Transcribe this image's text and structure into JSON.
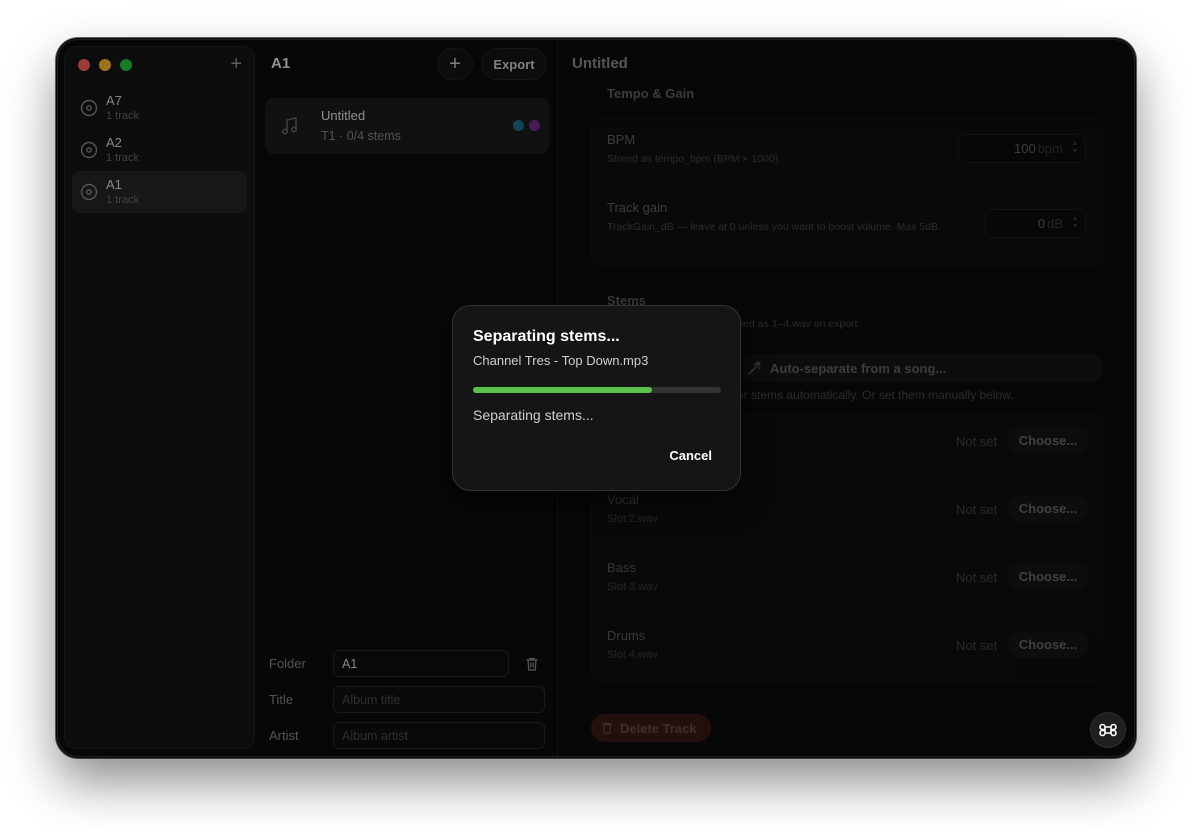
{
  "sidebar": {
    "add_label": "+",
    "items": [
      {
        "name": "A7",
        "sub": "1 track",
        "selected": false
      },
      {
        "name": "A2",
        "sub": "1 track",
        "selected": false
      },
      {
        "name": "A1",
        "sub": "1 track",
        "selected": true
      }
    ]
  },
  "album": {
    "title": "A1",
    "add_label": "+",
    "export_label": "Export",
    "track": {
      "title": "Untitled",
      "subtitle": "T1 · 0/4 stems",
      "colors": [
        "#1c6f8c",
        "#7a2a93"
      ]
    },
    "fields": {
      "folder_label": "Folder",
      "folder_value": "A1",
      "title_label": "Title",
      "title_placeholder": "Album title",
      "artist_label": "Artist",
      "artist_placeholder": "Album artist"
    }
  },
  "detail": {
    "title": "Untitled",
    "tempo_section": "Tempo & Gain",
    "bpm": {
      "label": "BPM",
      "desc": "Stored as tempo_bpm (BPM × 1000).",
      "value": "100",
      "unit": "bpm"
    },
    "gain": {
      "label": "Track gain",
      "desc": "TrackGain_dB — leave at 0 unless you want to boost volume. Max 5dB.",
      "value": "0",
      "unit": "dB"
    },
    "stems_section": "Stems",
    "stems_desc": "pied as 1–4.wav on export.",
    "auto_label": "Auto-separate from a song...",
    "auto_hint": "ar stems automatically. Or set them manually below.",
    "stems": [
      {
        "name": "",
        "file": "",
        "status": "Not set",
        "button": "Choose..."
      },
      {
        "name": "Vocal",
        "file": "Slot 2.wav",
        "status": "Not set",
        "button": "Choose..."
      },
      {
        "name": "Bass",
        "file": "Slot 3.wav",
        "status": "Not set",
        "button": "Choose..."
      },
      {
        "name": "Drums",
        "file": "Slot 4.wav",
        "status": "Not set",
        "button": "Choose..."
      }
    ],
    "delete_label": "Delete Track"
  },
  "modal": {
    "title": "Separating stems...",
    "file": "Channel Tres - Top Down.mp3",
    "progress": 0.72,
    "status": "Separating stems...",
    "cancel_label": "Cancel",
    "progress_color": "#5ac24a"
  }
}
